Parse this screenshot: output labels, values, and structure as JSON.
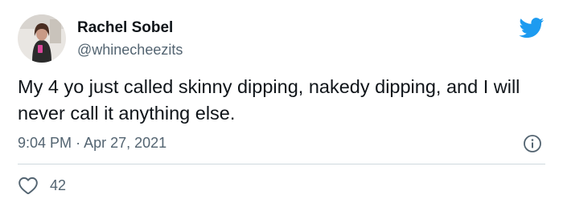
{
  "author": {
    "name": "Rachel Sobel",
    "handle": "@whinecheezits"
  },
  "tweet": {
    "text": "My 4 yo just called skinny dipping, nakedy dipping, and I will never call it anything else.",
    "time": "9:04 PM",
    "separator": "·",
    "date": "Apr 27, 2021"
  },
  "engagement": {
    "likes": "42"
  },
  "icons": {
    "brand": "twitter-bird-icon",
    "info": "info-icon",
    "like": "heart-icon"
  },
  "colors": {
    "brand_blue": "#1d9bf0",
    "secondary_text": "#536471",
    "primary_text": "#0f1419",
    "divider": "#cfd9de"
  }
}
